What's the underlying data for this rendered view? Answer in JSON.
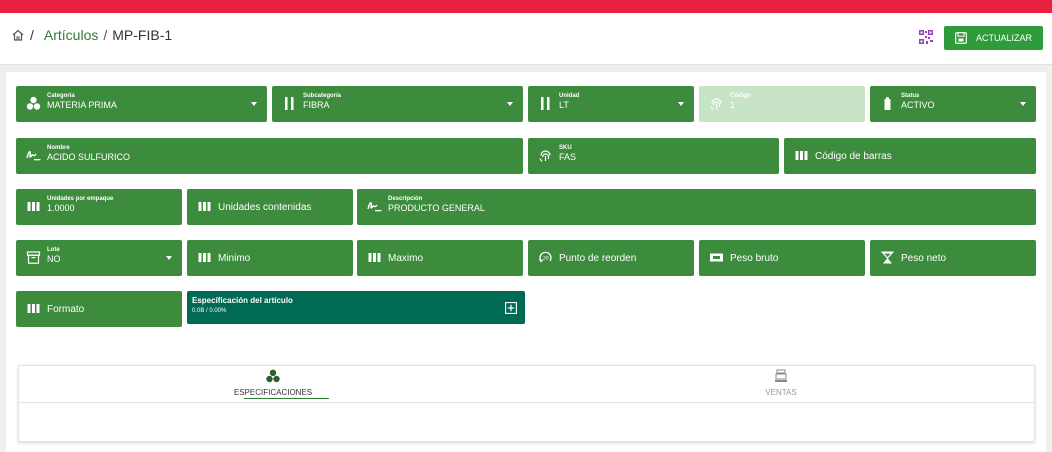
{
  "breadcrumb": {
    "section": "Artículos",
    "current": "MP-FIB-1"
  },
  "header": {
    "update_label": "ACTUALIZAR"
  },
  "fields": {
    "categoria": {
      "label": "Categoría",
      "value": "MATERIA PRIMA"
    },
    "subcategoria": {
      "label": "Subcategoría",
      "value": "FIBRA"
    },
    "unidad": {
      "label": "Unidad",
      "value": "LT"
    },
    "codigo": {
      "label": "Código",
      "value": "1"
    },
    "status": {
      "label": "Status",
      "value": "ACTIVO"
    },
    "nombre": {
      "label": "Nombre",
      "value": "ACIDO SULFURICO"
    },
    "sku": {
      "label": "SKU",
      "value": "FAS"
    },
    "codigo_barras": {
      "label": "Código de barras"
    },
    "unidades_empaque": {
      "label": "Unidades por empaque",
      "value": "1.0000"
    },
    "unidades_contenidas": {
      "label": "Unidades contenidas"
    },
    "descripcion": {
      "label": "Descripción",
      "value": "PRODUCTO GENERAL"
    },
    "lote": {
      "label": "Lote",
      "value": "NO"
    },
    "minimo": {
      "label": "Minimo"
    },
    "maximo": {
      "label": "Maximo"
    },
    "punto_reorden": {
      "label": "Punto de reorden"
    },
    "peso_bruto": {
      "label": "Peso bruto"
    },
    "peso_neto": {
      "label": "Peso neto"
    },
    "formato": {
      "label": "Formato"
    },
    "especificacion": {
      "label": "Especificación del artículo",
      "value": "0.0B / 0.00%"
    }
  },
  "tabs": [
    {
      "label": "ESPECIFICACIONES",
      "icon": "cubes-icon"
    },
    {
      "label": "VENTAS",
      "icon": "cash-register-icon"
    }
  ],
  "colors": {
    "topbar": "#e8223f",
    "field": "#3d8b3d",
    "field_disabled": "#c7e4c7",
    "spec": "#006a55",
    "button": "#2e9c3a"
  }
}
